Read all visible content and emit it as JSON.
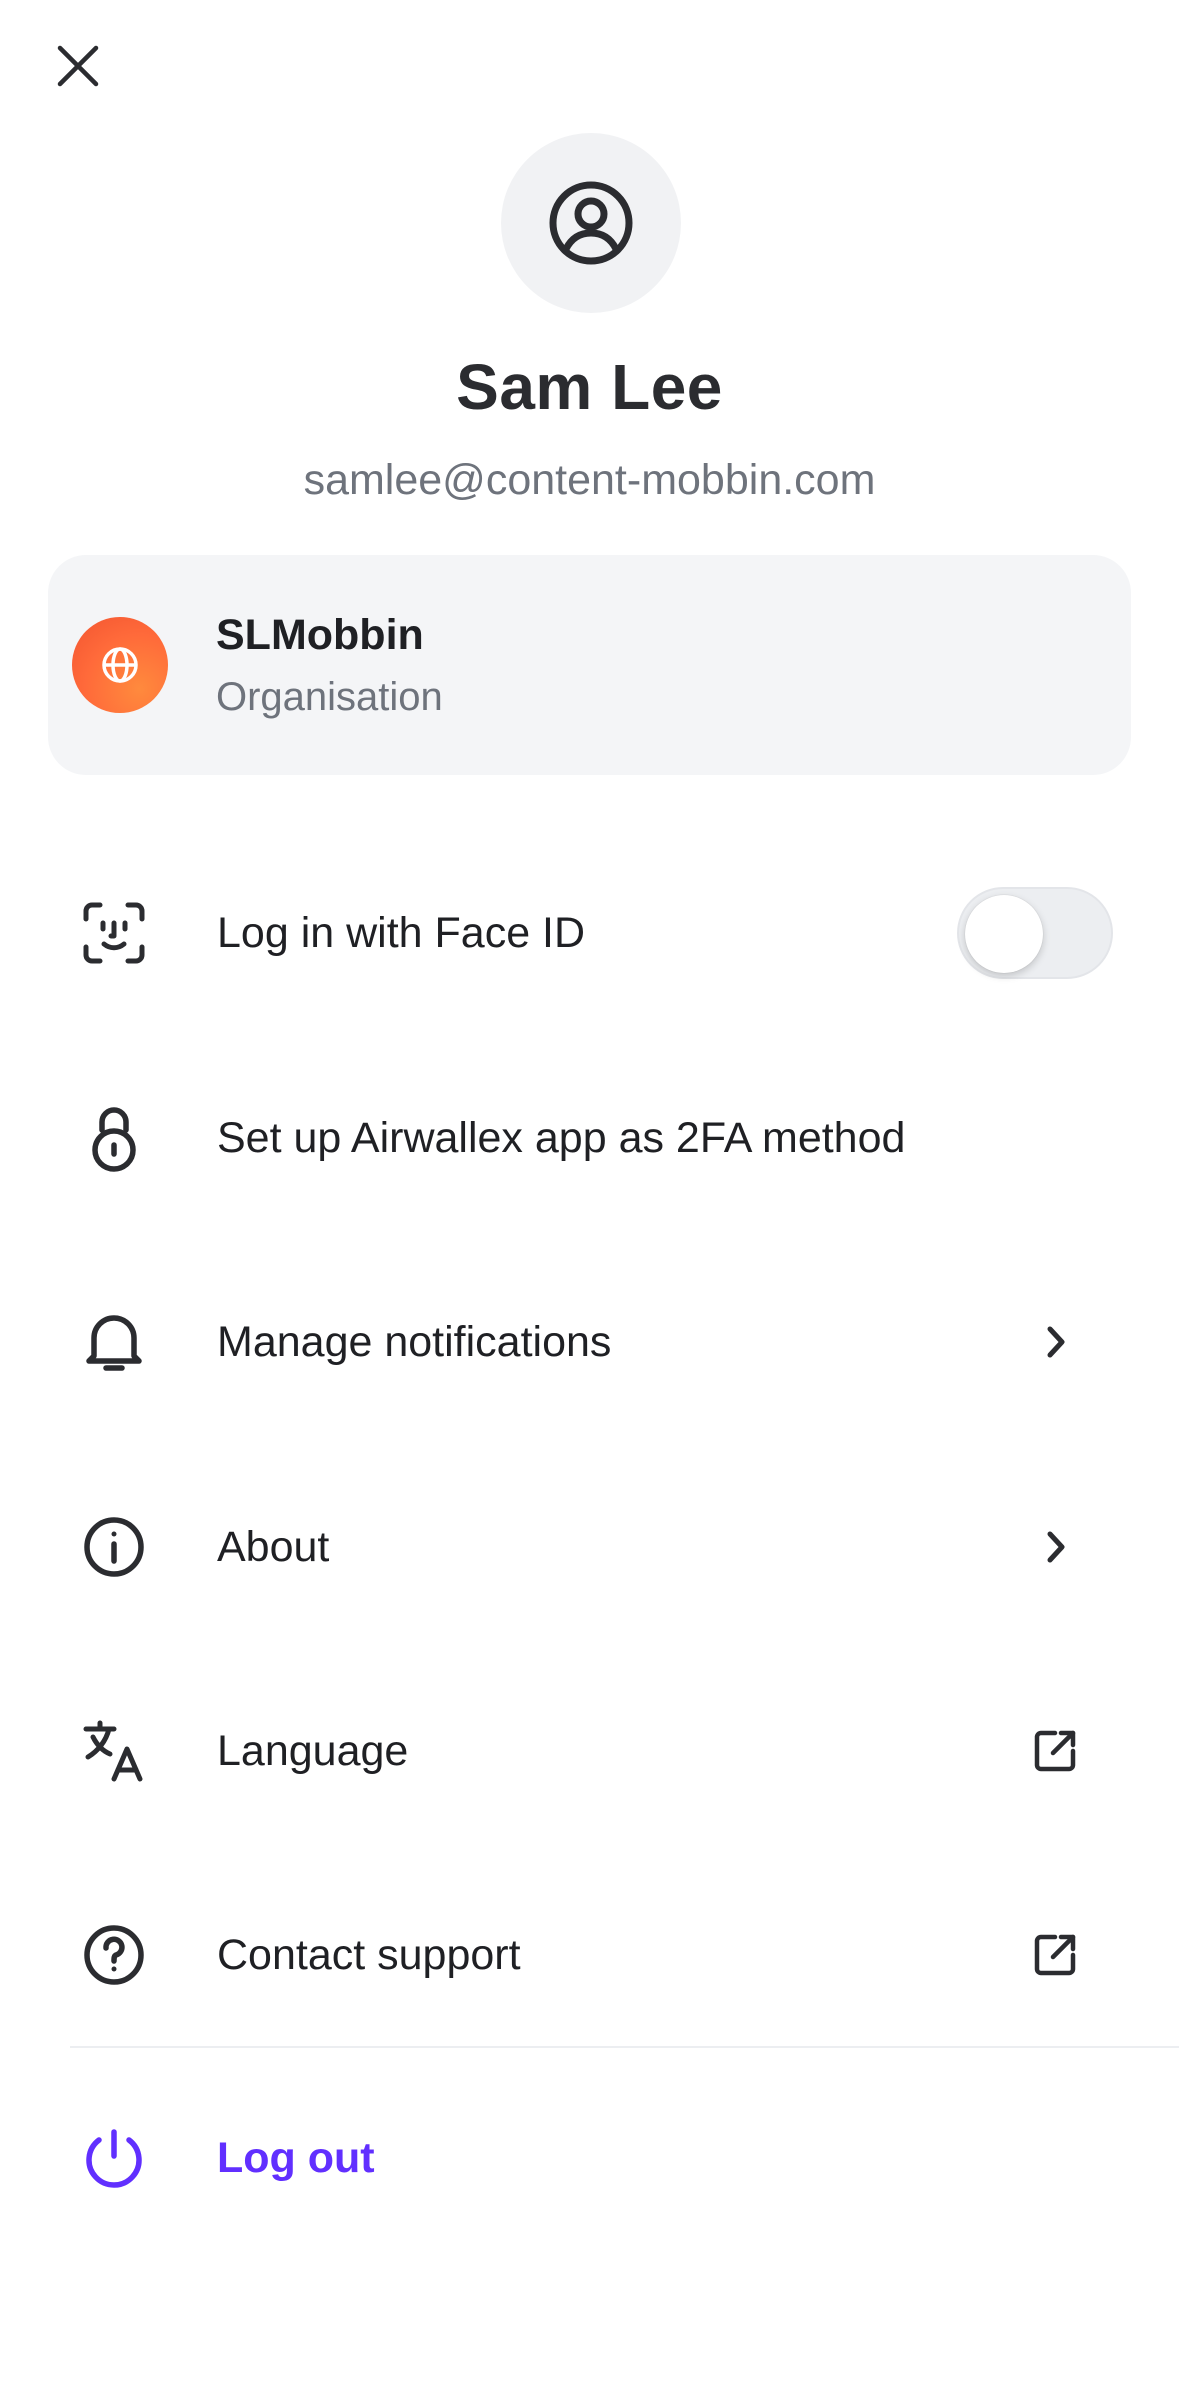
{
  "profile": {
    "name": "Sam Lee",
    "email": "samlee@content-mobbin.com",
    "avatar_icon": "user-circle-icon"
  },
  "organisation": {
    "name": "SLMobbin",
    "type": "Organisation",
    "badge_icon": "globe-icon",
    "badge_color": "#ff6a3a"
  },
  "menu": {
    "face_id": {
      "label": "Log in with Face ID",
      "icon": "face-id-icon",
      "enabled": false
    },
    "two_fa": {
      "label": "Set up Airwallex app as 2FA method",
      "icon": "lock-icon"
    },
    "notifications": {
      "label": "Manage notifications",
      "icon": "bell-icon",
      "trail_icon": "chevron-right-icon"
    },
    "about": {
      "label": "About",
      "icon": "info-icon",
      "trail_icon": "chevron-right-icon"
    },
    "language": {
      "label": "Language",
      "icon": "translate-icon",
      "trail_icon": "external-link-icon"
    },
    "support": {
      "label": "Contact support",
      "icon": "help-circle-icon",
      "trail_icon": "external-link-icon"
    },
    "logout": {
      "label": "Log out",
      "icon": "power-icon",
      "color": "#612fff"
    }
  }
}
